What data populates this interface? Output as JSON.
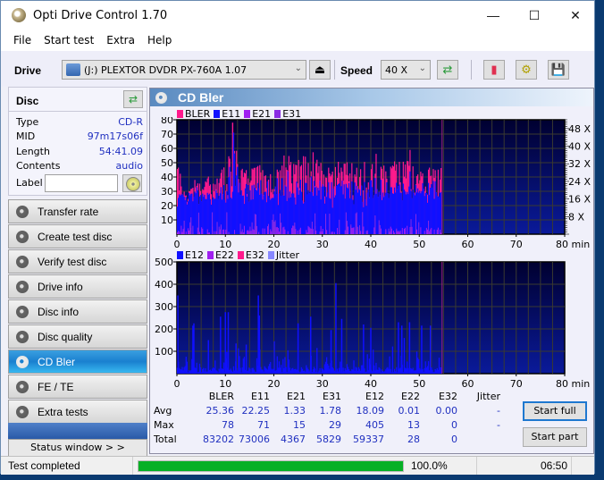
{
  "window": {
    "title": "Opti Drive Control 1.70",
    "controls": {
      "minimize": "—",
      "maximize": "☐",
      "close": "✕"
    }
  },
  "menu": [
    "File",
    "Start test",
    "Extra",
    "Help"
  ],
  "toolbar": {
    "drive_label": "Drive",
    "drive_value": "(J:)  PLEXTOR DVDR   PX-760A 1.07",
    "speed_label": "Speed",
    "speed_value": "40 X",
    "icons": [
      "eject-icon",
      "refresh-icon",
      "erase-icon",
      "settings-icon",
      "save-icon"
    ]
  },
  "disc": {
    "header": "Disc",
    "fields": [
      {
        "key": "Type",
        "value": "CD-R"
      },
      {
        "key": "MID",
        "value": "97m17s06f"
      },
      {
        "key": "Length",
        "value": "54:41.09"
      },
      {
        "key": "Contents",
        "value": "audio"
      }
    ],
    "label_key": "Label",
    "label_value": ""
  },
  "nav": [
    {
      "label": "Transfer rate",
      "active": false
    },
    {
      "label": "Create test disc",
      "active": false
    },
    {
      "label": "Verify test disc",
      "active": false
    },
    {
      "label": "Drive info",
      "active": false
    },
    {
      "label": "Disc info",
      "active": false
    },
    {
      "label": "Disc quality",
      "active": false
    },
    {
      "label": "CD Bler",
      "active": true
    },
    {
      "label": "FE / TE",
      "active": false
    },
    {
      "label": "Extra tests",
      "active": false
    }
  ],
  "status_window_button": "Status window > >",
  "panel": {
    "title": "CD Bler"
  },
  "chart_data": [
    {
      "type": "bar",
      "title": "CD Bler (upper)",
      "legend": [
        {
          "name": "BLER",
          "color": "#ff1a8c"
        },
        {
          "name": "E11",
          "color": "#1010ff"
        },
        {
          "name": "E21",
          "color": "#a020f0"
        },
        {
          "name": "E31",
          "color": "#8a2be2"
        }
      ],
      "xlabel": "min",
      "xlim": [
        0,
        80
      ],
      "xticks": [
        "0",
        "10",
        "20",
        "30",
        "40",
        "50",
        "60",
        "70",
        "80 min"
      ],
      "ylim": [
        0,
        80
      ],
      "yticks": [
        "10",
        "20",
        "30",
        "40",
        "50",
        "60",
        "70",
        "80"
      ],
      "y2ticks": [
        "8 X",
        "16 X",
        "24 X",
        "32 X",
        "40 X",
        "48 X"
      ],
      "end_marker_min": 54.7,
      "grid": true,
      "series_summary": {
        "BLER": {
          "avg": 25.36,
          "max": 78,
          "peak_at_min": 11.5
        },
        "E11": {
          "avg": 22.25,
          "max": 71
        },
        "E21": {
          "avg": 1.33,
          "max": 15
        },
        "E31": {
          "avg": 1.78,
          "max": 29
        }
      },
      "envelope": {
        "x": [
          0,
          2,
          4,
          6,
          8,
          10,
          11,
          12,
          13,
          14,
          16,
          18,
          20,
          22,
          24,
          26,
          28,
          30,
          32,
          34,
          36,
          38,
          40,
          42,
          44,
          46,
          48,
          50,
          52,
          54,
          54.7
        ],
        "bler": [
          52,
          30,
          40,
          42,
          38,
          50,
          60,
          78,
          50,
          45,
          48,
          52,
          45,
          60,
          52,
          55,
          58,
          50,
          45,
          55,
          50,
          48,
          65,
          50,
          48,
          55,
          60,
          50,
          48,
          50,
          45
        ],
        "e11": [
          30,
          28,
          35,
          32,
          33,
          40,
          55,
          71,
          45,
          40,
          40,
          45,
          40,
          55,
          45,
          45,
          50,
          42,
          40,
          45,
          42,
          42,
          50,
          42,
          40,
          45,
          55,
          40,
          40,
          40,
          35
        ]
      }
    },
    {
      "type": "bar",
      "title": "CD Bler (lower)",
      "legend": [
        {
          "name": "E12",
          "color": "#1010ff"
        },
        {
          "name": "E22",
          "color": "#a020f0"
        },
        {
          "name": "E32",
          "color": "#ff1a8c"
        },
        {
          "name": "Jitter",
          "color": "#8888ff"
        }
      ],
      "xlabel": "min",
      "xlim": [
        0,
        80
      ],
      "xticks": [
        "0",
        "10",
        "20",
        "30",
        "40",
        "50",
        "60",
        "70",
        "80 min"
      ],
      "ylim": [
        0,
        500
      ],
      "yticks": [
        "100",
        "200",
        "300",
        "400",
        "500"
      ],
      "end_marker_min": 54.7,
      "grid": true,
      "series_summary": {
        "E12": {
          "avg": 18.09,
          "max": 405,
          "peak_at_min": 32.8
        },
        "E22": {
          "avg": 0.01,
          "max": 13
        },
        "E32": {
          "avg": 0.0,
          "max": 0
        }
      },
      "peaks": {
        "x": [
          0.2,
          3.3,
          3.5,
          6.5,
          9.0,
          10.0,
          10.6,
          12.2,
          14.3,
          16.8,
          17.0,
          25.0,
          27.6,
          31.8,
          32.8,
          34.0,
          38.5,
          40.0,
          45.7,
          46.4,
          48.0,
          50.5,
          52.3
        ],
        "e12": [
          350,
          215,
          225,
          150,
          255,
          275,
          275,
          135,
          130,
          350,
          260,
          225,
          255,
          195,
          405,
          245,
          220,
          205,
          230,
          215,
          230,
          215,
          215
        ]
      }
    }
  ],
  "stats": {
    "columns": [
      "BLER",
      "E11",
      "E21",
      "E31",
      "E12",
      "E22",
      "E32",
      "Jitter"
    ],
    "rows": [
      {
        "label": "Avg",
        "values": [
          "25.36",
          "22.25",
          "1.33",
          "1.78",
          "18.09",
          "0.01",
          "0.00",
          "-"
        ]
      },
      {
        "label": "Max",
        "values": [
          "78",
          "71",
          "15",
          "29",
          "405",
          "13",
          "0",
          "-"
        ]
      },
      {
        "label": "Total",
        "values": [
          "83202",
          "73006",
          "4367",
          "5829",
          "59337",
          "28",
          "0",
          ""
        ]
      }
    ]
  },
  "buttons": {
    "start_full": "Start full",
    "start_part": "Start part"
  },
  "statusbar": {
    "message": "Test completed",
    "progress_percent": 100.0,
    "progress_text": "100.0%",
    "elapsed": "06:50"
  }
}
